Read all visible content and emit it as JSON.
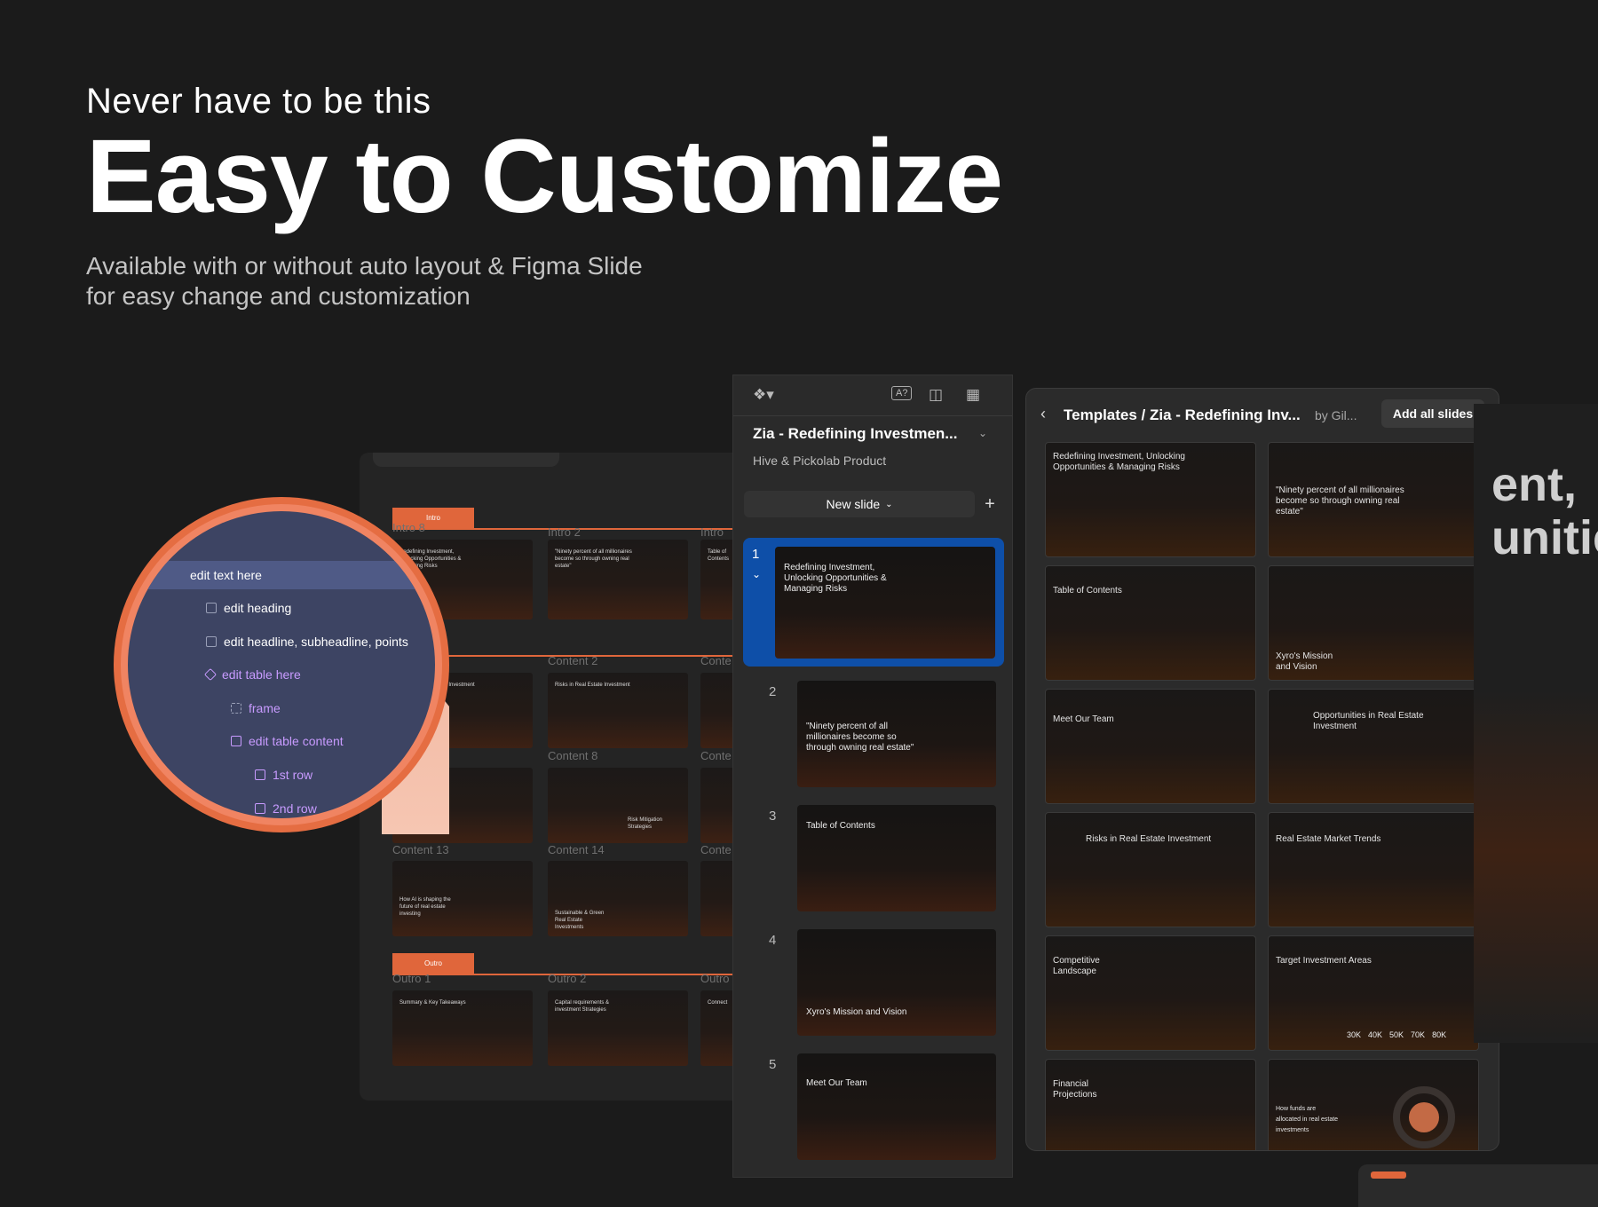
{
  "hero": {
    "eyebrow": "Never have to be this",
    "title": "Easy to Customize",
    "subtitle_line1": "Available with or without auto layout  & Figma Slide",
    "subtitle_line2": "for easy change and customization"
  },
  "canvas": {
    "section_tags": [
      "Intro",
      "Outro"
    ],
    "slide_labels": [
      "Intro 8",
      "Intro 2",
      "Intro",
      "Content 2",
      "Conte",
      "Content 8",
      "Conte",
      "Content 13",
      "Content 14",
      "Conte",
      "Outro 1",
      "Outro 2",
      "Outro"
    ],
    "thumb_titles": [
      "Redefining Investment, Unlocking Opportunities & Managing Risks",
      "\"Ninety percent of all millionaires become so through owning real estate\"",
      "Table of Contents",
      "Risks in Real Estate Investment",
      "Risks in Real Estate Investment",
      "How AI is shaping the future of real estate investing",
      "Risk Mitigation Strategies",
      "Sustainable & Green Real Estate Investments",
      "Summary & Key Takeaways",
      "Capital requirements & investment Strategies",
      "Connect"
    ]
  },
  "layers": {
    "items": [
      {
        "label": "edit text here",
        "icon": "text-icon"
      },
      {
        "label": "edit heading",
        "icon": "frame-icon"
      },
      {
        "label": "edit headline, subheadline, points",
        "icon": "stack-icon"
      },
      {
        "label": "edit table here",
        "icon": "component-icon"
      },
      {
        "label": "frame",
        "icon": "frame-select-icon"
      },
      {
        "label": "edit table content",
        "icon": "stack-icon"
      },
      {
        "label": "1st row",
        "icon": "frame-icon"
      },
      {
        "label": "2nd row",
        "icon": "frame-icon"
      }
    ]
  },
  "sidebar": {
    "file_title": "Zia - Redefining Investmen...",
    "file_subtitle": "Hive & Pickolab Product",
    "new_slide_label": "New slide",
    "slides": [
      {
        "num": "1",
        "title": "Redefining Investment, Unlocking Opportunities & Managing Risks"
      },
      {
        "num": "2",
        "title": "\"Ninety percent of all millionaires become so through owning real estate\""
      },
      {
        "num": "3",
        "title": "Table of Contents"
      },
      {
        "num": "4",
        "title": "Xyro's Mission and Vision"
      },
      {
        "num": "5",
        "title": "Meet Our Team"
      }
    ]
  },
  "templates": {
    "breadcrumb": "Templates / Zia - Redefining Inv...",
    "author": "by Gil...",
    "add_all_label": "Add all slides",
    "cards": [
      "Redefining Investment, Unlocking Opportunities & Managing Risks",
      "\"Ninety percent of all millionaires become so through owning real estate\"",
      "Table of Contents",
      "Xyro's Mission and Vision",
      "Meet Our Team",
      "Opportunities in Real Estate Investment",
      "Risks in Real Estate Investment",
      "Real Estate Market Trends",
      "Competitive Landscape",
      "Target Investment Areas",
      "Financial Projections",
      "How funds are allocated in real estate investments"
    ],
    "target_values": [
      "30K",
      "40K",
      "50K",
      "70K",
      "80K"
    ]
  },
  "edge": {
    "line1": "ent,",
    "line2": "unitie"
  }
}
